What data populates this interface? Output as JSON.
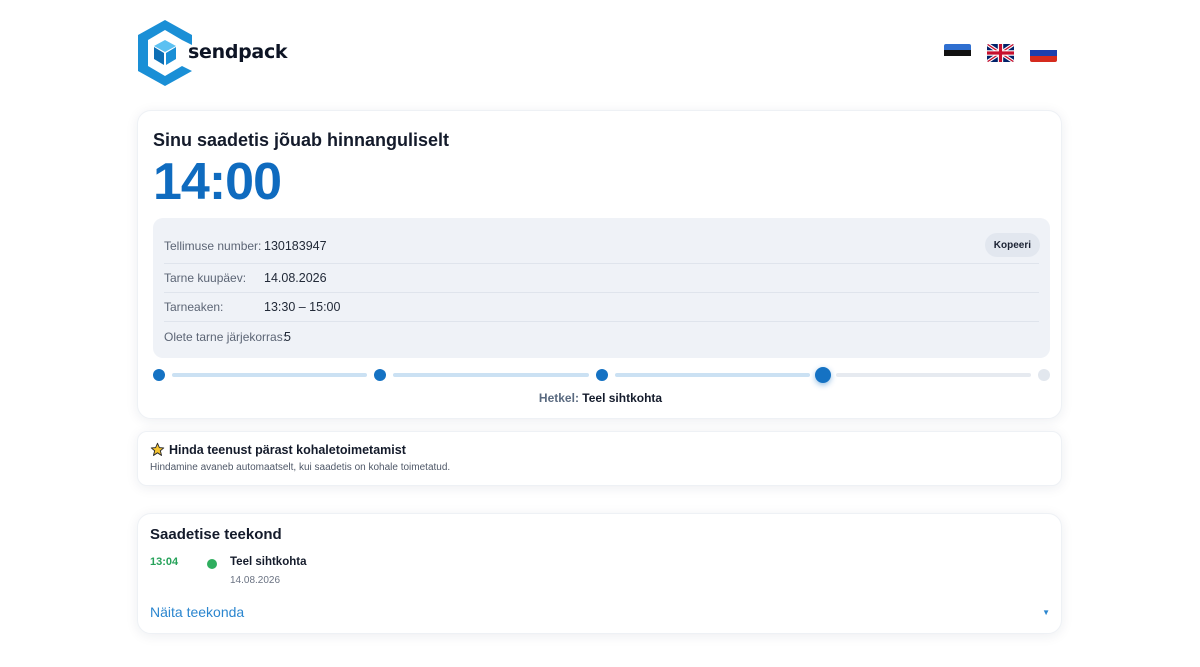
{
  "brand": {
    "name": "sendpack",
    "accent": "#1a8fd6"
  },
  "languages": [
    {
      "code": "et",
      "icon": "flag-estonia-icon"
    },
    {
      "code": "en",
      "icon": "flag-uk-icon"
    },
    {
      "code": "ru",
      "icon": "flag-russia-icon"
    }
  ],
  "eta": {
    "title": "Sinu saadetis jõuab hinnanguliselt",
    "time": "14:00",
    "copy_label": "Kopeeri",
    "details": [
      {
        "label": "Tellimuse number:",
        "value": "130183947"
      },
      {
        "label": "Tarne kuupäev:",
        "value": "14.08.2026"
      },
      {
        "label": "Tarneaken:",
        "value": "13:30 – 15:00"
      },
      {
        "label": "Olete tarne järjekorras:",
        "value": "5"
      }
    ],
    "progress": {
      "total_steps": 5,
      "current_step": 4
    },
    "status_label": "Hetkel:",
    "status_value": "Teel sihtkohta"
  },
  "rating": {
    "icon": "star-icon",
    "title": "Hinda teenust pärast kohaletoimetamist",
    "description": "Hindamine avaneb automaatselt, kui saadetis on kohale toimetatud."
  },
  "journey": {
    "title": "Saadetise teekond",
    "events": [
      {
        "time": "13:04",
        "status": "Teel sihtkohta",
        "date": "14.08.2026"
      }
    ],
    "show_label": "Näita teekonda",
    "status_color": "#2fae5f"
  }
}
